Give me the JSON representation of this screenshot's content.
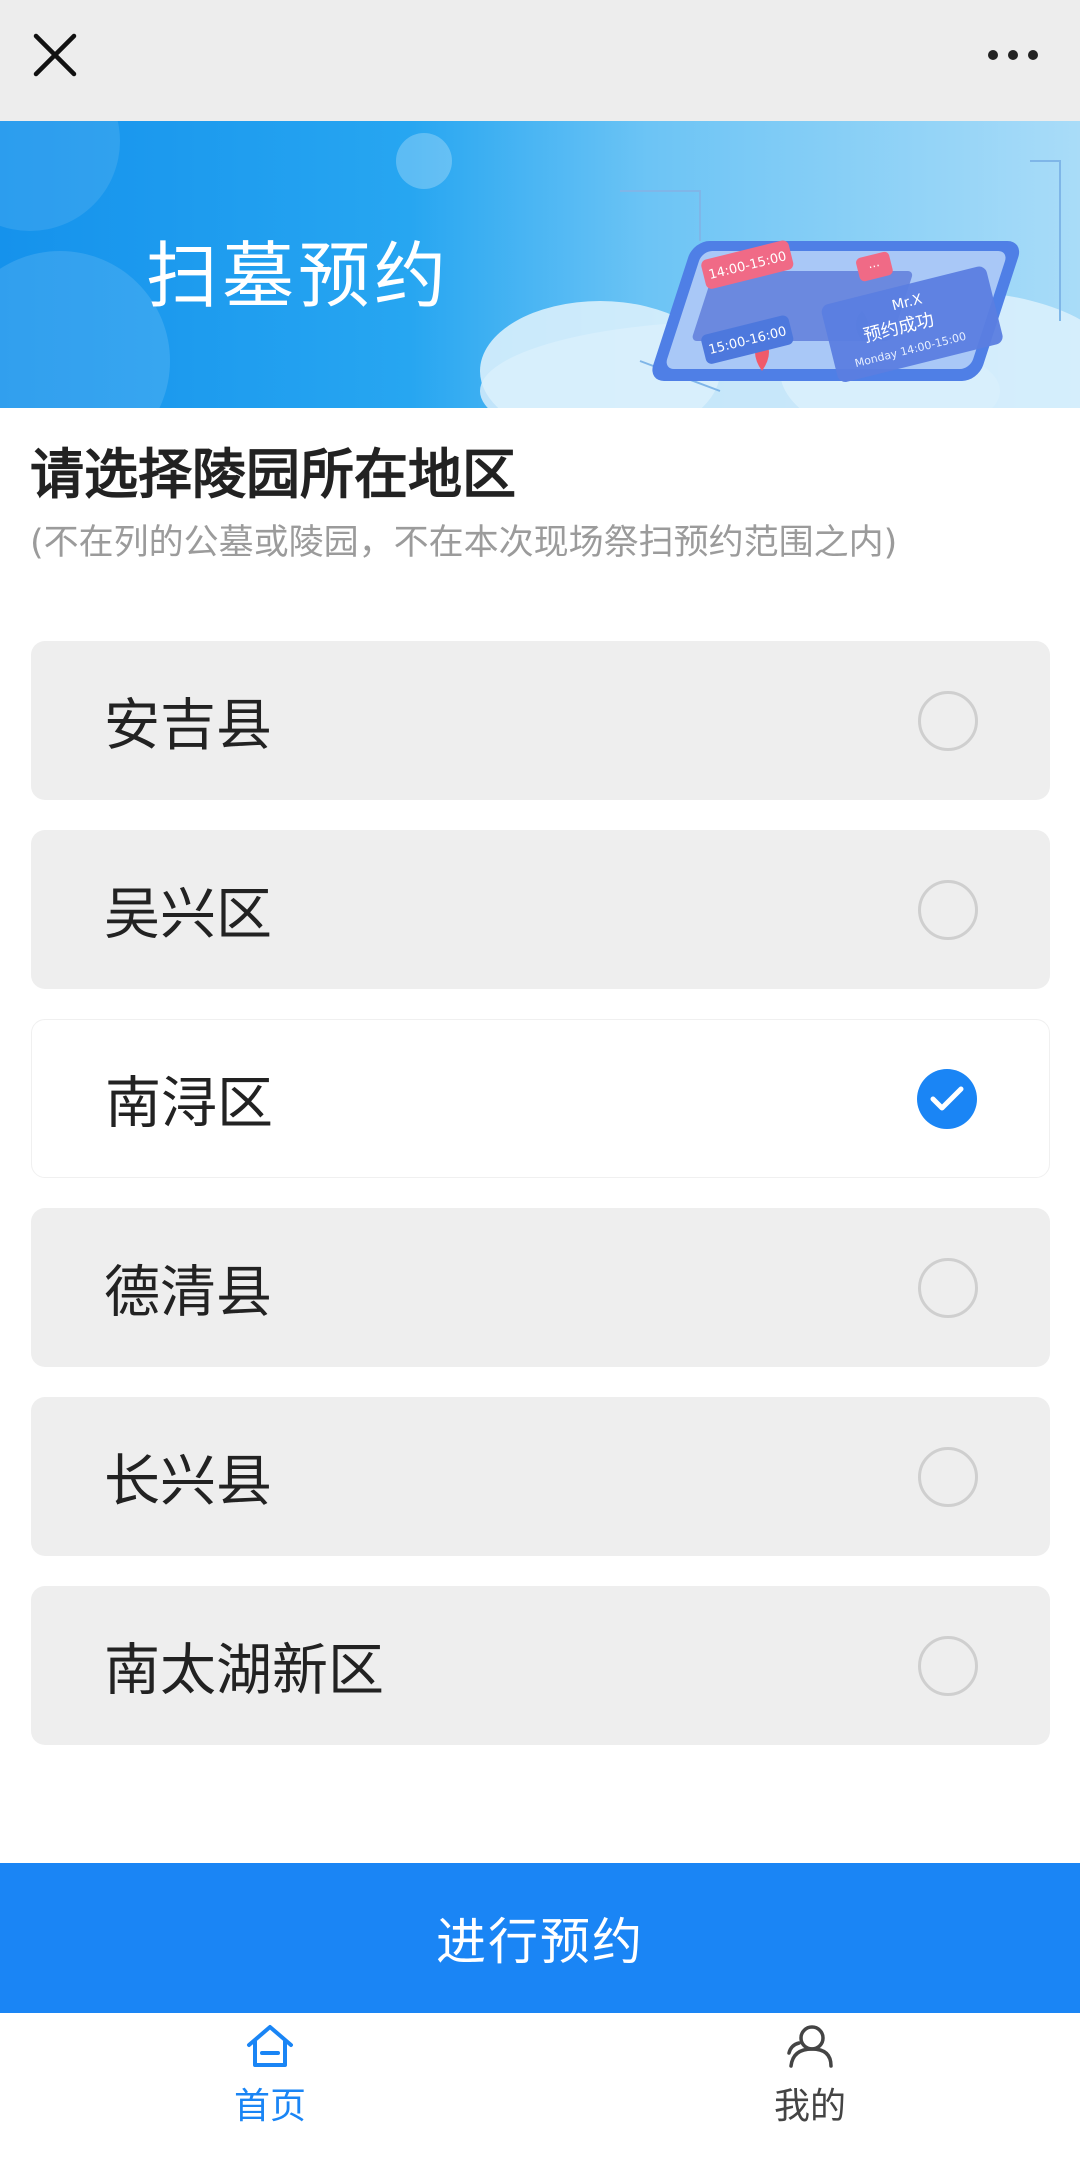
{
  "topbar": {
    "close_icon": "close-icon",
    "more_icon": "more-icon"
  },
  "banner": {
    "title": "扫墓预约",
    "illustration_texts": [
      "14:00-15:00",
      "15:00-16:00",
      "Mr.X",
      "预约成功",
      "Monday 14:00-15:00"
    ]
  },
  "heading": {
    "title": "请选择陵园所在地区",
    "subtitle": "(不在列的公墓或陵园，不在本次现场祭扫预约范围之内)"
  },
  "regions": [
    {
      "label": "安吉县",
      "selected": false
    },
    {
      "label": "吴兴区",
      "selected": false
    },
    {
      "label": "南浔区",
      "selected": true
    },
    {
      "label": "德清县",
      "selected": false
    },
    {
      "label": "长兴县",
      "selected": false
    },
    {
      "label": "南太湖新区",
      "selected": false
    }
  ],
  "submit": {
    "label": "进行预约"
  },
  "tabbar": {
    "home": {
      "label": "首页",
      "icon": "home-icon",
      "active": true
    },
    "mine": {
      "label": "我的",
      "icon": "user-icon",
      "active": false
    }
  },
  "colors": {
    "accent": "#1a85f5",
    "item_bg": "#eeeeee",
    "topbar_bg": "#ededed"
  }
}
